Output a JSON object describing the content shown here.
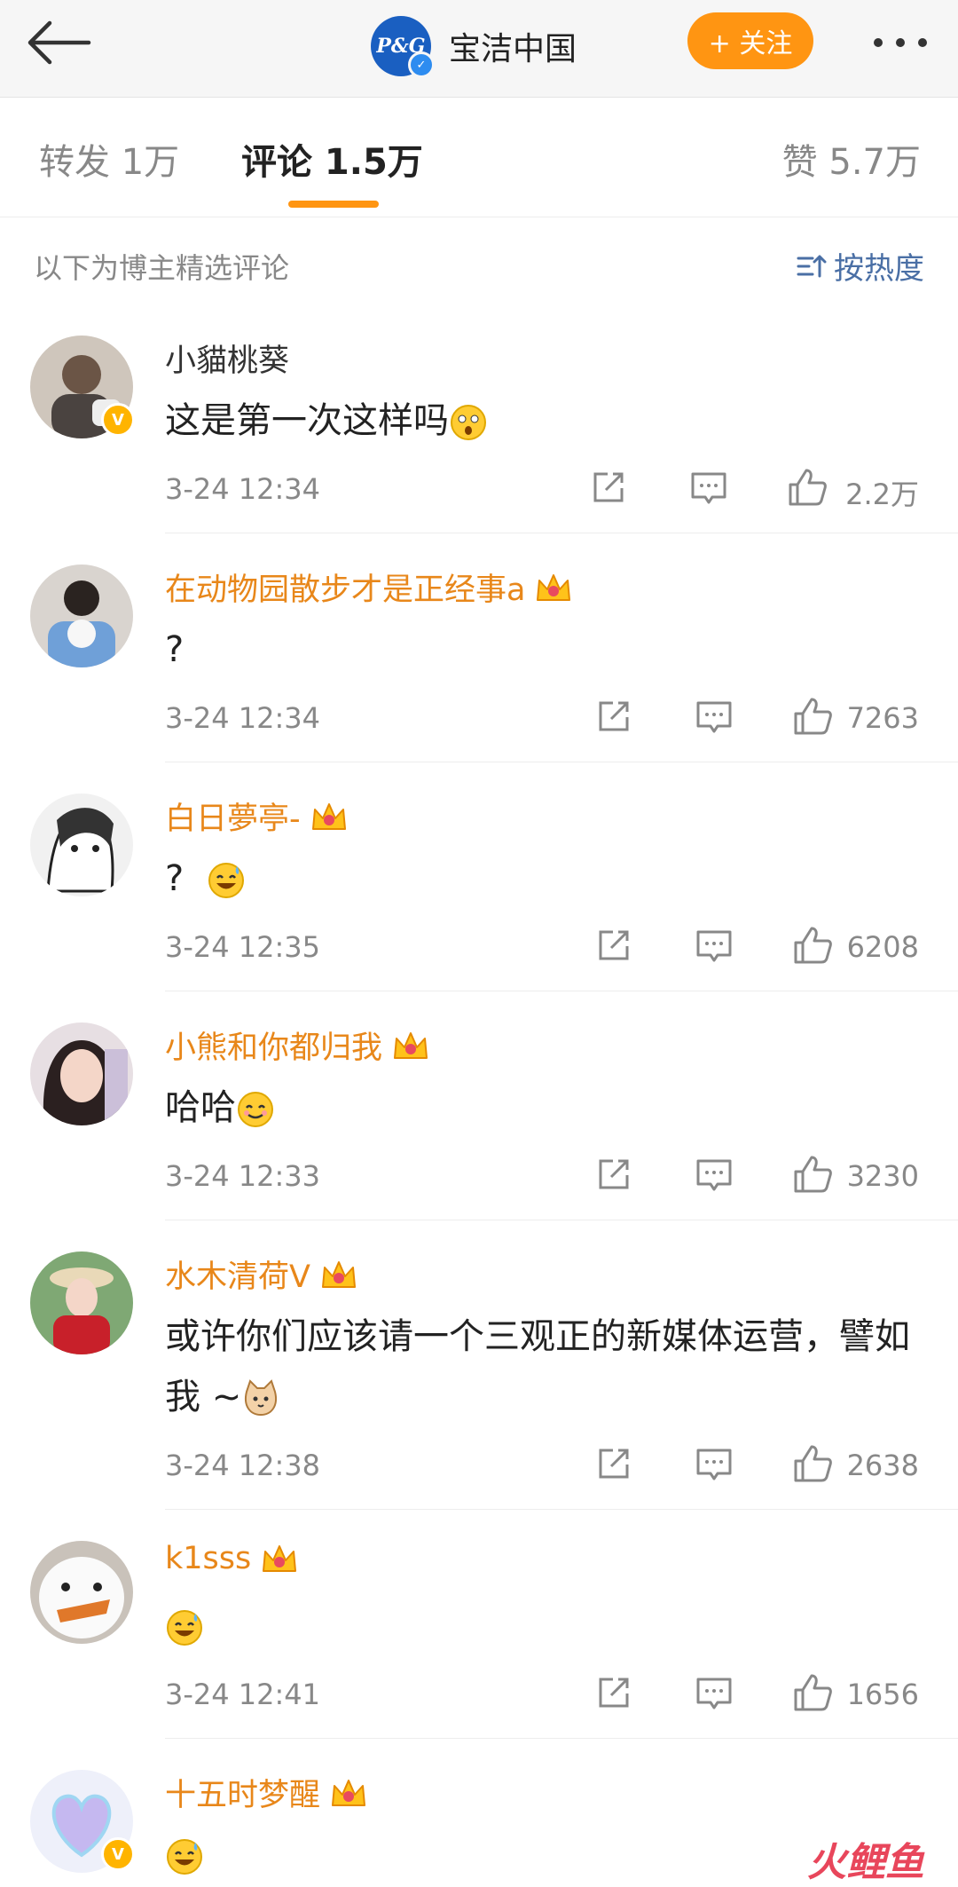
{
  "header": {
    "brand_logo_text": "P&G",
    "brand_name": "宝洁中国",
    "follow_label": "+ 关注"
  },
  "tabs": [
    {
      "label": "转发 1万"
    },
    {
      "label": "评论 1.5万",
      "active": true
    },
    {
      "label": "赞 5.7万"
    }
  ],
  "notice": {
    "text": "以下为博主精选评论",
    "sort_label": "按热度"
  },
  "comments": [
    {
      "user": "小貓桃葵",
      "text": "这是第一次这样吗",
      "time": "3-24 12:34",
      "likes": "2.2万"
    },
    {
      "user": "在动物园散步才是正经事a",
      "text": "?",
      "time": "3-24 12:34",
      "likes": "7263"
    },
    {
      "user": "白日夢亭-",
      "text": "?",
      "time": "3-24 12:35",
      "likes": "6208"
    },
    {
      "user": "小熊和你都归我",
      "text": "哈哈",
      "time": "3-24 12:33",
      "likes": "3230"
    },
    {
      "user": "水木清荷V",
      "text": "或许你们应该请一个三观正的新媒体运营，譬如我 ~",
      "time": "3-24 12:38",
      "likes": "2638"
    },
    {
      "user": "k1sss",
      "text": "",
      "time": "3-24 12:41",
      "likes": "1656"
    },
    {
      "user": "十五时梦醒",
      "text": "",
      "time": "",
      "likes": ""
    }
  ],
  "colors": {
    "accent": "#ff9512",
    "username_vip": "#e8871a",
    "link": "#4a6fa5"
  },
  "watermark": "火鲤鱼"
}
